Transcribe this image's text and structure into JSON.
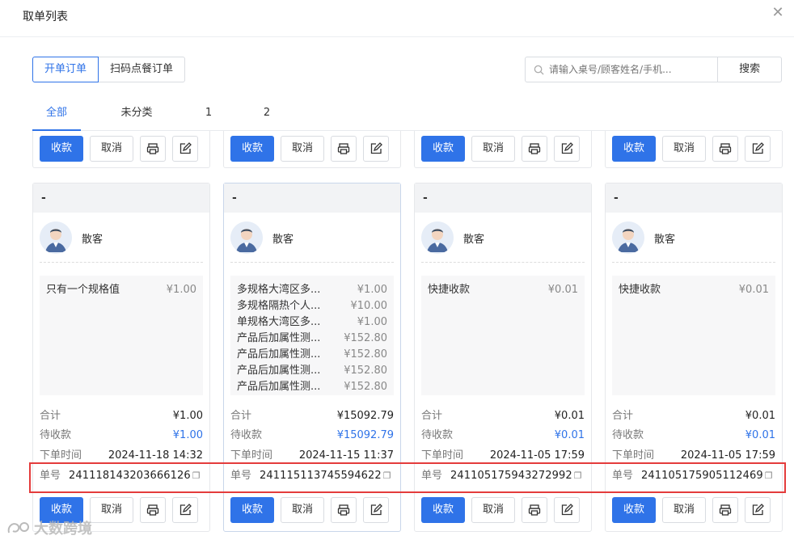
{
  "dialog": {
    "title": "取单列表"
  },
  "segments": [
    "开单订单",
    "扫码点餐订单"
  ],
  "search": {
    "placeholder": "请输入桌号/顾客姓名/手机...",
    "button": "搜索"
  },
  "tabs": [
    "全部",
    "未分类",
    "1",
    "2"
  ],
  "actions": {
    "pay": "收款",
    "cancel": "取消"
  },
  "cards": [
    {
      "header": "-",
      "customer": "散客",
      "items": [
        {
          "name": "只有一个规格值",
          "price": "¥1.00"
        }
      ],
      "total_label": "合计",
      "total": "¥1.00",
      "pending_label": "待收款",
      "pending": "¥1.00",
      "time_label": "下单时间",
      "time": "2024-11-18 14:32",
      "order_label": "单号",
      "order_no": "241118143203666126"
    },
    {
      "header": "-",
      "customer": "散客",
      "items": [
        {
          "name": "多规格大湾区多...",
          "price": "¥1.00"
        },
        {
          "name": "多规格隔热个人...",
          "price": "¥10.00"
        },
        {
          "name": "单规格大湾区多...",
          "price": "¥1.00"
        },
        {
          "name": "产品后加属性测...",
          "price": "¥152.80"
        },
        {
          "name": "产品后加属性测...",
          "price": "¥152.80"
        },
        {
          "name": "产品后加属性测...",
          "price": "¥152.80"
        },
        {
          "name": "产品后加属性测...",
          "price": "¥152.80"
        }
      ],
      "total_label": "合计",
      "total": "¥15092.79",
      "pending_label": "待收款",
      "pending": "¥15092.79",
      "time_label": "下单时间",
      "time": "2024-11-15 11:37",
      "order_label": "单号",
      "order_no": "241115113745594622"
    },
    {
      "header": "-",
      "customer": "散客",
      "items": [
        {
          "name": "快捷收款",
          "price": "¥0.01"
        }
      ],
      "total_label": "合计",
      "total": "¥0.01",
      "pending_label": "待收款",
      "pending": "¥0.01",
      "time_label": "下单时间",
      "time": "2024-11-05 17:59",
      "order_label": "单号",
      "order_no": "241105175943272992"
    },
    {
      "header": "-",
      "customer": "散客",
      "items": [
        {
          "name": "快捷收款",
          "price": "¥0.01"
        }
      ],
      "total_label": "合计",
      "total": "¥0.01",
      "pending_label": "待收款",
      "pending": "¥0.01",
      "time_label": "下单时间",
      "time": "2024-11-05 17:59",
      "order_label": "单号",
      "order_no": "241105175905112469"
    }
  ],
  "watermark": "大数跨境",
  "colors": {
    "accent": "#2f73e8",
    "highlight": "#e43c3c"
  }
}
